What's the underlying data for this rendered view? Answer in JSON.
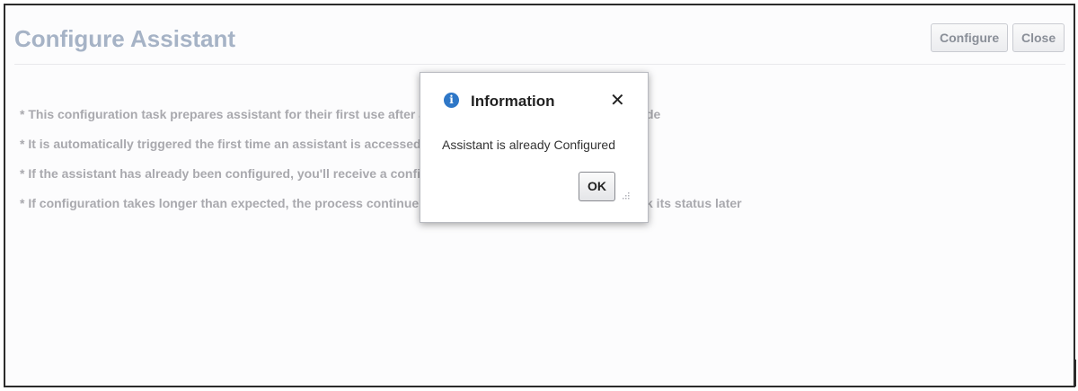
{
  "header": {
    "title": "Configure Assistant",
    "configure_label": "Configure",
    "close_label": "Close"
  },
  "bullets": [
    "* This configuration task prepares assistant for their first use after a",
    "* It is automatically triggered the first time an assistant is accessed",
    "* If the assistant has already been configured, you'll receive a confi",
    "* If configuration takes longer than expected, the process continue"
  ],
  "bullet_tails": [
    "de",
    "",
    "",
    "k its status later"
  ],
  "dialog": {
    "icon": "info-icon",
    "title": "Information",
    "close_glyph": "✕",
    "message": "Assistant is already Configured",
    "ok_label": "OK"
  },
  "colors": {
    "title": "#a6b3c6",
    "info_icon": "#2e77c7"
  }
}
